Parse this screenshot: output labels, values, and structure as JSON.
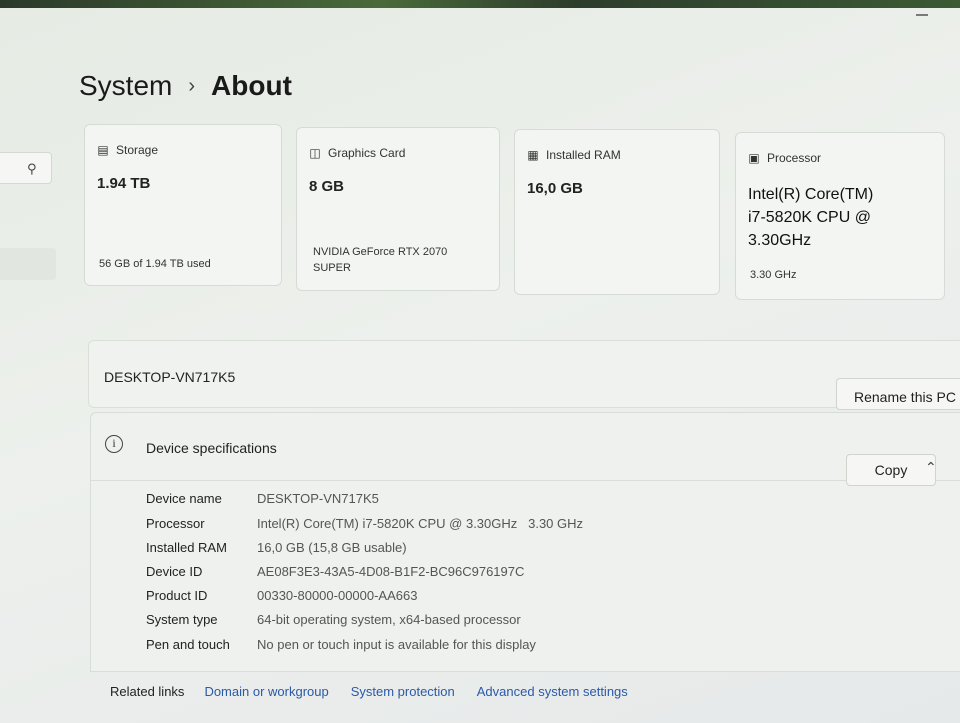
{
  "breadcrumb": {
    "parent": "System",
    "separator": "›",
    "current": "About"
  },
  "cards": [
    {
      "label": "Storage",
      "icon": "hard-drive-icon",
      "value": "1.94 TB",
      "sub": "56 GB of 1.94 TB used"
    },
    {
      "label": "Graphics Card",
      "icon": "gpu-icon",
      "value": "8 GB",
      "sub_line1": "NVIDIA GeForce RTX 2070",
      "sub_line2": "SUPER"
    },
    {
      "label": "Installed RAM",
      "icon": "ram-icon",
      "value": "16,0 GB"
    },
    {
      "label": "Processor",
      "icon": "cpu-icon",
      "value_line1": "Intel(R) Core(TM)",
      "value_line2": "i7-5820K CPU @",
      "value_line3": "3.30GHz",
      "sub": "3.30 GHz"
    }
  ],
  "pc": {
    "name": "DESKTOP-VN717K5",
    "rename_label": "Rename this PC"
  },
  "device_specs": {
    "title": "Device specifications",
    "copy_label": "Copy",
    "rows": [
      {
        "key": "Device name",
        "value": "DESKTOP-VN717K5"
      },
      {
        "key": "Processor",
        "value": "Intel(R) Core(TM) i7-5820K CPU @ 3.30GHz   3.30 GHz"
      },
      {
        "key": "Installed RAM",
        "value": "16,0 GB (15,8 GB usable)"
      },
      {
        "key": "Device ID",
        "value": "AE08F3E3-43A5-4D08-B1F2-BC96C976197C"
      },
      {
        "key": "Product ID",
        "value": "00330-80000-00000-AA663"
      },
      {
        "key": "System type",
        "value": "64-bit operating system, x64-based processor"
      },
      {
        "key": "Pen and touch",
        "value": "No pen or touch input is available for this display"
      }
    ]
  },
  "related": {
    "title": "Related links",
    "links": [
      "Domain or workgroup",
      "System protection",
      "Advanced system settings"
    ]
  },
  "colors": {
    "link": "#2a5aa8",
    "card_bg": "#f3f5f2",
    "page_bg": "#e9ede8"
  }
}
